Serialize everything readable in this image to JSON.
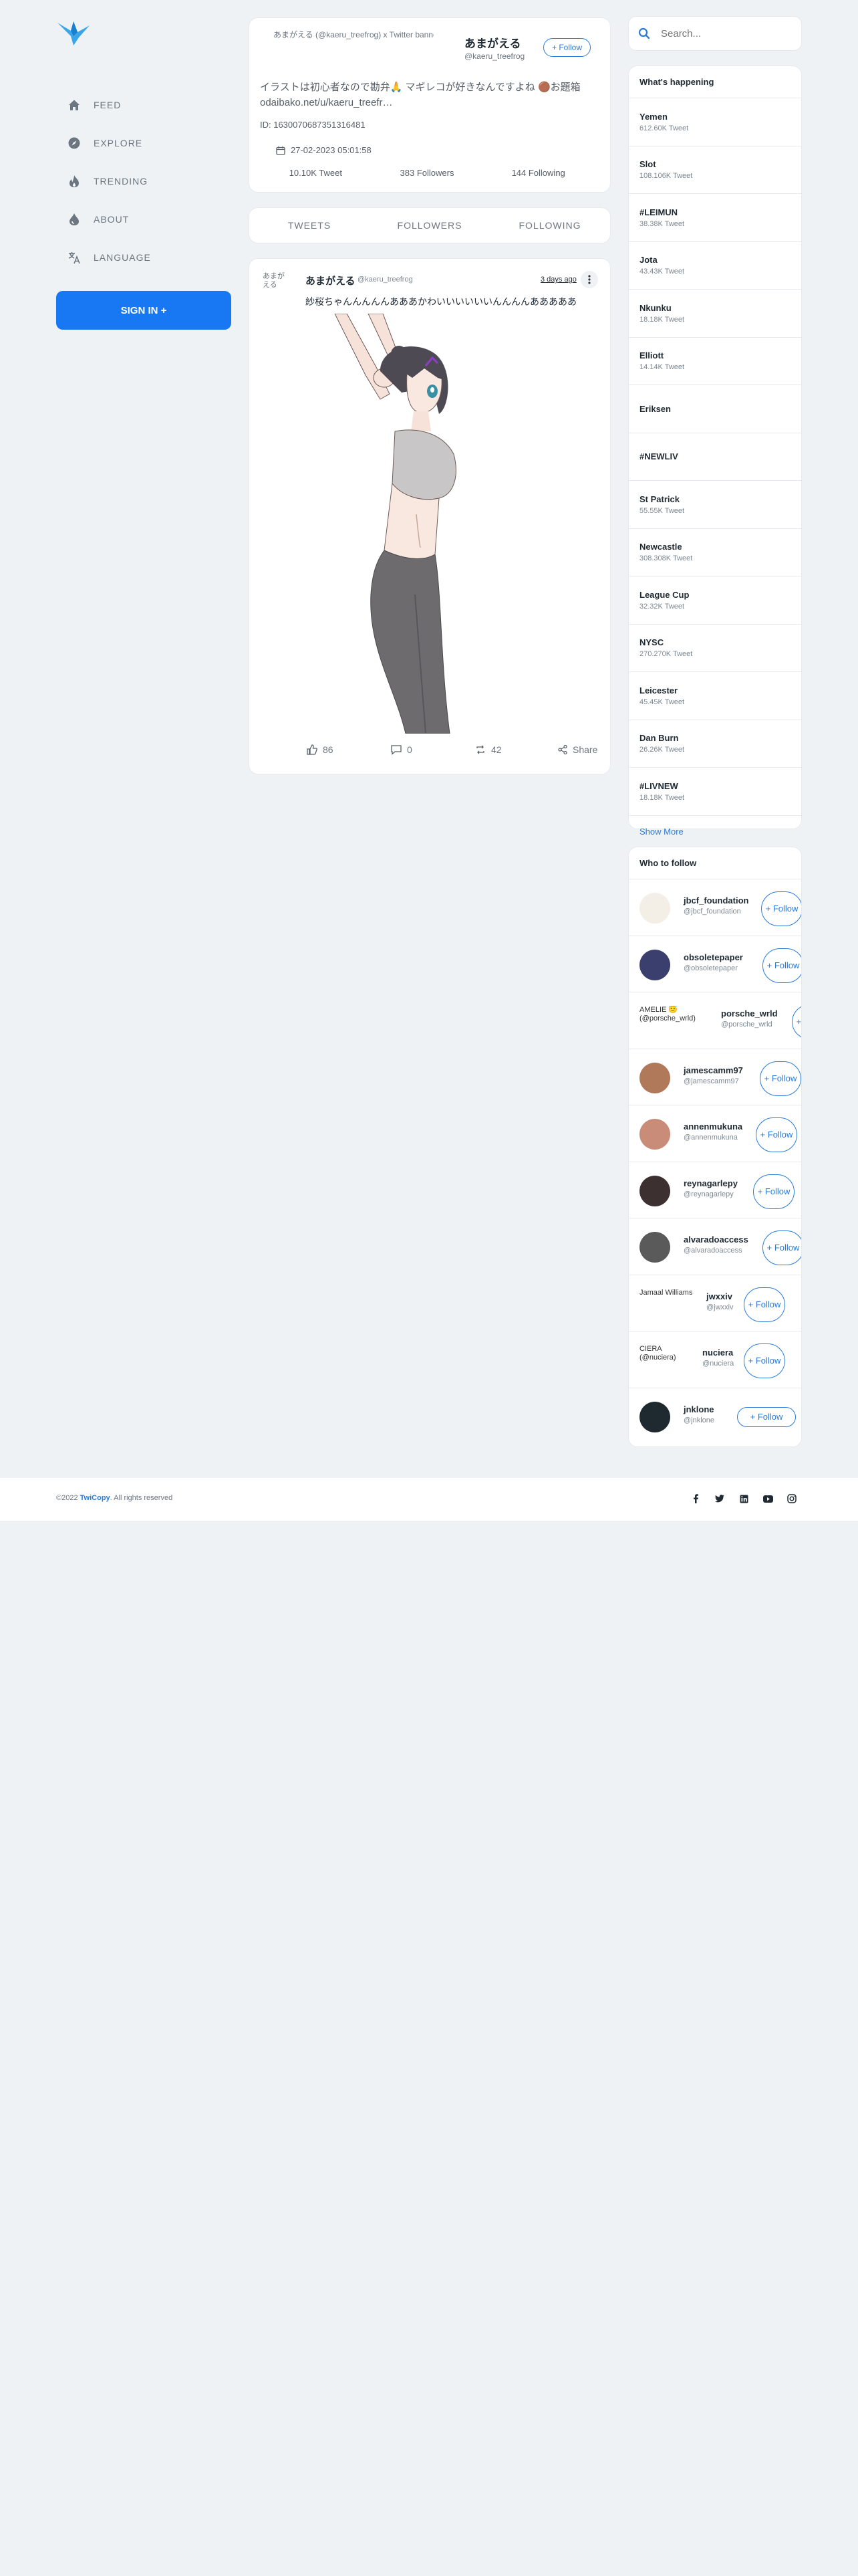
{
  "nav": {
    "items": [
      {
        "label": "FEED",
        "icon": "home-icon"
      },
      {
        "label": "EXPLORE",
        "icon": "compass-icon"
      },
      {
        "label": "TRENDING",
        "icon": "flame-icon"
      },
      {
        "label": "ABOUT",
        "icon": "drop-icon"
      },
      {
        "label": "LANGUAGE",
        "icon": "translate-icon"
      }
    ],
    "signin_label": "SIGN IN +"
  },
  "profile": {
    "banner_alt": "あまがえる (@kaeru_treefrog) x Twitter banner",
    "name": "あまがえる",
    "handle": "@kaeru_treefrog",
    "follow_label": "+ Follow",
    "bio_line1": "イラストは初心者なので勘弁🙏 マギレコが好きなんですよね 🟤お題箱",
    "bio_line2": "odaibako.net/u/kaeru_treefr…",
    "id_text": "ID: 1630070687351316481",
    "date": "27-02-2023 05:01:58",
    "tweets": "10.10K Tweet",
    "followers": "383 Followers",
    "following": "144 Following"
  },
  "tabs": [
    "TWEETS",
    "FOLLOWERS",
    "FOLLOWING"
  ],
  "tweet": {
    "avatar_alt": "あまがえる",
    "name": "あまがえる",
    "handle": "@kaeru_treefrog",
    "date": "3 days ago",
    "text": "紗桜ちゃんんんんんあああかわいいいいいいんんんんあああああ",
    "likes": "86",
    "comments": "0",
    "retweets": "42",
    "share_label": "Share"
  },
  "search": {
    "placeholder": "Search..."
  },
  "trends": {
    "title": "What's happening",
    "items": [
      {
        "name": "Yemen",
        "count": "612.60K Tweet"
      },
      {
        "name": "Slot",
        "count": "108.106K Tweet"
      },
      {
        "name": "#LEIMUN",
        "count": "38.38K Tweet"
      },
      {
        "name": "Jota",
        "count": "43.43K Tweet"
      },
      {
        "name": "Nkunku",
        "count": "18.18K Tweet"
      },
      {
        "name": "Elliott",
        "count": "14.14K Tweet"
      },
      {
        "name": "Eriksen",
        "count": ""
      },
      {
        "name": "#NEWLIV",
        "count": ""
      },
      {
        "name": "St Patrick",
        "count": "55.55K Tweet"
      },
      {
        "name": "Newcastle",
        "count": "308.308K Tweet"
      },
      {
        "name": "League Cup",
        "count": "32.32K Tweet"
      },
      {
        "name": "NYSC",
        "count": "270.270K Tweet"
      },
      {
        "name": "Leicester",
        "count": "45.45K Tweet"
      },
      {
        "name": "Dan Burn",
        "count": "26.26K Tweet"
      },
      {
        "name": "#LIVNEW",
        "count": "18.18K Tweet"
      }
    ],
    "show_more": "Show More"
  },
  "who_to_follow": {
    "title": "Who to follow",
    "follow_label": "+ Follow",
    "users": [
      {
        "name": "jbcf_foundation",
        "handle": "@jbcf_foundation",
        "avatar_alt": ""
      },
      {
        "name": "obsoletepaper",
        "handle": "@obsoletepaper",
        "avatar_alt": ""
      },
      {
        "name": "porsche_wrld",
        "handle": "@porsche_wrld",
        "avatar_alt": "AMELIE 😇 (@porsche_wrld)"
      },
      {
        "name": "jamescamm97",
        "handle": "@jamescamm97",
        "avatar_alt": ""
      },
      {
        "name": "annenmukuna",
        "handle": "@annenmukuna",
        "avatar_alt": ""
      },
      {
        "name": "reynagarlepy",
        "handle": "@reynagarlepy",
        "avatar_alt": ""
      },
      {
        "name": "alvaradoaccess",
        "handle": "@alvaradoaccess",
        "avatar_alt": ""
      },
      {
        "name": "jwxxiv",
        "handle": "@jwxxiv",
        "avatar_alt": "Jamaal Williams"
      },
      {
        "name": "nuciera",
        "handle": "@nuciera",
        "avatar_alt": "CIERA (@nuciera)"
      },
      {
        "name": "jnklone",
        "handle": "@jnklone",
        "avatar_alt": ""
      }
    ]
  },
  "footer": {
    "copy_prefix": "©2022",
    "brand": "TwiCopy",
    "copy_suffix": ". All rights reserved"
  }
}
